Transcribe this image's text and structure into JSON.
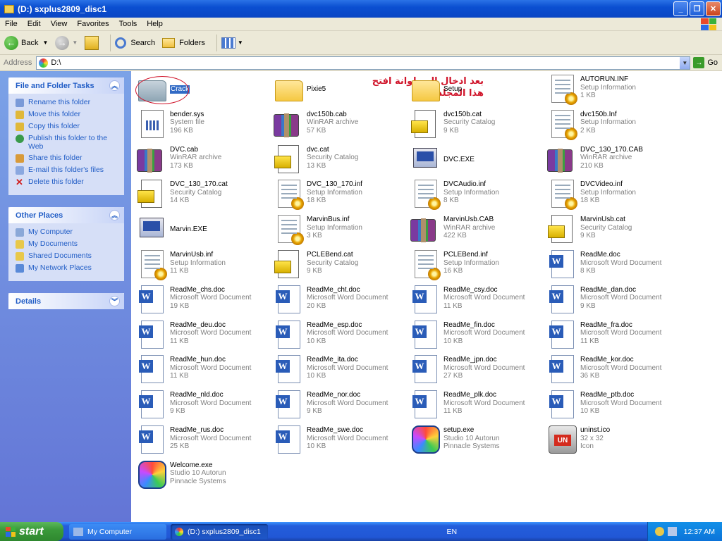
{
  "window": {
    "title": "(D:) sxplus2809_disc1"
  },
  "menu": [
    "File",
    "Edit",
    "View",
    "Favorites",
    "Tools",
    "Help"
  ],
  "toolbar": {
    "back": "Back",
    "search": "Search",
    "folders": "Folders"
  },
  "address": {
    "label": "Address",
    "value": "D:\\",
    "go": "Go"
  },
  "panels": {
    "tasks": {
      "title": "File and Folder Tasks",
      "items": [
        "Rename this folder",
        "Move this folder",
        "Copy this folder",
        "Publish this folder to the Web",
        "Share this folder",
        "E-mail this folder's files",
        "Delete this folder"
      ]
    },
    "places": {
      "title": "Other Places",
      "items": [
        "My Computer",
        "My Documents",
        "Shared Documents",
        "My Network Places"
      ]
    },
    "details": {
      "title": "Details"
    }
  },
  "annotation": {
    "line1": "بعد ادخال السطوانة افتح",
    "line2": "هذا المجلد"
  },
  "files": [
    {
      "name": "Crack",
      "sub1": "",
      "sub2": "",
      "icon": "folder-grey-icon",
      "selected": true
    },
    {
      "name": "Pixie5",
      "sub1": "",
      "sub2": "",
      "icon": "folder-icon"
    },
    {
      "name": "Setup",
      "sub1": "",
      "sub2": "",
      "icon": "folder-icon"
    },
    {
      "name": "AUTORUN.INF",
      "sub1": "Setup Information",
      "sub2": "1 KB",
      "icon": "inf-icon"
    },
    {
      "name": "bender.sys",
      "sub1": "System file",
      "sub2": "196 KB",
      "icon": "sys-icon"
    },
    {
      "name": "dvc150b.cab",
      "sub1": "WinRAR archive",
      "sub2": "57 KB",
      "icon": "rar-icon"
    },
    {
      "name": "dvc150b.cat",
      "sub1": "Security Catalog",
      "sub2": "9 KB",
      "icon": "cat-icon"
    },
    {
      "name": "dvc150b.Inf",
      "sub1": "Setup Information",
      "sub2": "2 KB",
      "icon": "inf-icon"
    },
    {
      "name": "DVC.cab",
      "sub1": "WinRAR archive",
      "sub2": "173 KB",
      "icon": "rar-icon"
    },
    {
      "name": "dvc.cat",
      "sub1": "Security Catalog",
      "sub2": "13 KB",
      "icon": "cat-icon"
    },
    {
      "name": "DVC.EXE",
      "sub1": "",
      "sub2": "",
      "icon": "exe-icon"
    },
    {
      "name": "DVC_130_170.CAB",
      "sub1": "WinRAR archive",
      "sub2": "210 KB",
      "icon": "rar-icon"
    },
    {
      "name": "DVC_130_170.cat",
      "sub1": "Security Catalog",
      "sub2": "14 KB",
      "icon": "cat-icon"
    },
    {
      "name": "DVC_130_170.inf",
      "sub1": "Setup Information",
      "sub2": "18 KB",
      "icon": "inf-icon"
    },
    {
      "name": "DVCAudio.inf",
      "sub1": "Setup Information",
      "sub2": "8 KB",
      "icon": "inf-icon"
    },
    {
      "name": "DVCVideo.inf",
      "sub1": "Setup Information",
      "sub2": "18 KB",
      "icon": "inf-icon"
    },
    {
      "name": "Marvin.EXE",
      "sub1": "",
      "sub2": "",
      "icon": "exe-icon"
    },
    {
      "name": "MarvinBus.inf",
      "sub1": "Setup Information",
      "sub2": "3 KB",
      "icon": "inf-icon"
    },
    {
      "name": "MarvinUsb.CAB",
      "sub1": "WinRAR archive",
      "sub2": "422 KB",
      "icon": "rar-icon"
    },
    {
      "name": "MarvinUsb.cat",
      "sub1": "Security Catalog",
      "sub2": "9 KB",
      "icon": "cat-icon"
    },
    {
      "name": "MarvinUsb.inf",
      "sub1": "Setup Information",
      "sub2": "11 KB",
      "icon": "inf-icon"
    },
    {
      "name": "PCLEBend.cat",
      "sub1": "Security Catalog",
      "sub2": "9 KB",
      "icon": "cat-icon"
    },
    {
      "name": "PCLEBend.inf",
      "sub1": "Setup Information",
      "sub2": "16 KB",
      "icon": "inf-icon"
    },
    {
      "name": "ReadMe.doc",
      "sub1": "Microsoft Word Document",
      "sub2": "8 KB",
      "icon": "word-icon"
    },
    {
      "name": "ReadMe_chs.doc",
      "sub1": "Microsoft Word Document",
      "sub2": "19 KB",
      "icon": "word-icon"
    },
    {
      "name": "ReadMe_cht.doc",
      "sub1": "Microsoft Word Document",
      "sub2": "20 KB",
      "icon": "word-icon"
    },
    {
      "name": "ReadMe_csy.doc",
      "sub1": "Microsoft Word Document",
      "sub2": "11 KB",
      "icon": "word-icon"
    },
    {
      "name": "ReadMe_dan.doc",
      "sub1": "Microsoft Word Document",
      "sub2": "9 KB",
      "icon": "word-icon"
    },
    {
      "name": "ReadMe_deu.doc",
      "sub1": "Microsoft Word Document",
      "sub2": "11 KB",
      "icon": "word-icon"
    },
    {
      "name": "ReadMe_esp.doc",
      "sub1": "Microsoft Word Document",
      "sub2": "10 KB",
      "icon": "word-icon"
    },
    {
      "name": "ReadMe_fin.doc",
      "sub1": "Microsoft Word Document",
      "sub2": "10 KB",
      "icon": "word-icon"
    },
    {
      "name": "ReadMe_fra.doc",
      "sub1": "Microsoft Word Document",
      "sub2": "11 KB",
      "icon": "word-icon"
    },
    {
      "name": "ReadMe_hun.doc",
      "sub1": "Microsoft Word Document",
      "sub2": "11 KB",
      "icon": "word-icon"
    },
    {
      "name": "ReadMe_ita.doc",
      "sub1": "Microsoft Word Document",
      "sub2": "10 KB",
      "icon": "word-icon"
    },
    {
      "name": "ReadMe_jpn.doc",
      "sub1": "Microsoft Word Document",
      "sub2": "27 KB",
      "icon": "word-icon"
    },
    {
      "name": "ReadMe_kor.doc",
      "sub1": "Microsoft Word Document",
      "sub2": "36 KB",
      "icon": "word-icon"
    },
    {
      "name": "ReadMe_nld.doc",
      "sub1": "Microsoft Word Document",
      "sub2": "9 KB",
      "icon": "word-icon"
    },
    {
      "name": "ReadMe_nor.doc",
      "sub1": "Microsoft Word Document",
      "sub2": "9 KB",
      "icon": "word-icon"
    },
    {
      "name": "ReadMe_plk.doc",
      "sub1": "Microsoft Word Document",
      "sub2": "11 KB",
      "icon": "word-icon"
    },
    {
      "name": "ReadMe_ptb.doc",
      "sub1": "Microsoft Word Document",
      "sub2": "10 KB",
      "icon": "word-icon"
    },
    {
      "name": "ReadMe_rus.doc",
      "sub1": "Microsoft Word Document",
      "sub2": "25 KB",
      "icon": "word-icon"
    },
    {
      "name": "ReadMe_swe.doc",
      "sub1": "Microsoft Word Document",
      "sub2": "10 KB",
      "icon": "word-icon"
    },
    {
      "name": "setup.exe",
      "sub1": "Studio 10 Autorun",
      "sub2": "Pinnacle Systems",
      "icon": "studio-icon"
    },
    {
      "name": "uninst.ico",
      "sub1": "32 x 32",
      "sub2": "Icon",
      "icon": "ico-icon"
    },
    {
      "name": "Welcome.exe",
      "sub1": "Studio 10 Autorun",
      "sub2": "Pinnacle Systems",
      "icon": "studio-icon"
    }
  ],
  "taskbar": {
    "start": "start",
    "buttons": [
      "My Computer",
      "(D:) sxplus2809_disc1"
    ],
    "lang": "EN",
    "clock": "12:37 AM"
  }
}
